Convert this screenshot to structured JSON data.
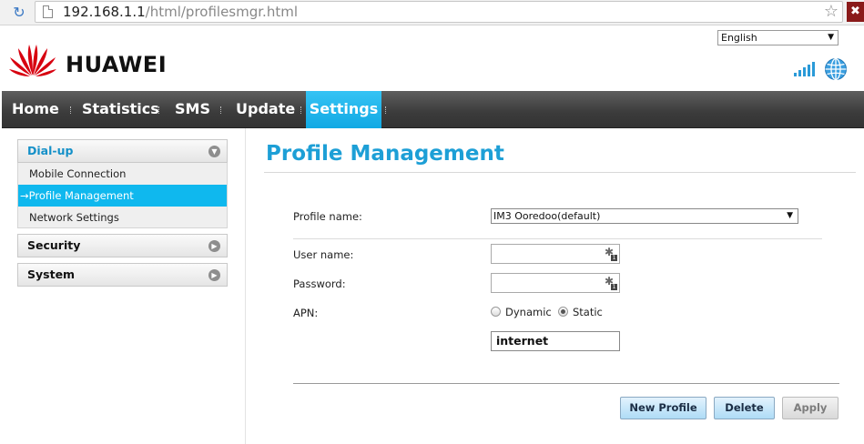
{
  "browser": {
    "url_host": "192.168.1.1",
    "url_path": "/html/profilesmgr.html"
  },
  "header": {
    "logo_text": "HUAWEI",
    "language_selected": "English"
  },
  "nav": {
    "items": [
      "Home",
      "Statistics",
      "SMS",
      "Update",
      "Settings"
    ],
    "active": "Settings"
  },
  "sidebar": {
    "dialup": {
      "label": "Dial-up",
      "items": [
        "Mobile Connection",
        "→Profile Management",
        "Network Settings"
      ]
    },
    "security": "Security",
    "system": "System"
  },
  "main": {
    "title": "Profile Management",
    "profile_name_label": "Profile name:",
    "profile_selected": "IM3 Ooredoo(default)",
    "user_name_label": "User name:",
    "user_name_value": "",
    "password_label": "Password:",
    "password_value": "",
    "apn_label": "APN:",
    "apn_options": [
      "Dynamic",
      "Static"
    ],
    "apn_selected": "Static",
    "apn_value": "internet",
    "buttons": {
      "new_profile": "New Profile",
      "delete": "Delete",
      "apply": "Apply"
    }
  },
  "colors": {
    "accent": "#1d9fd6",
    "nav_active": "#11a9e4",
    "logo_red": "#d7000f"
  }
}
